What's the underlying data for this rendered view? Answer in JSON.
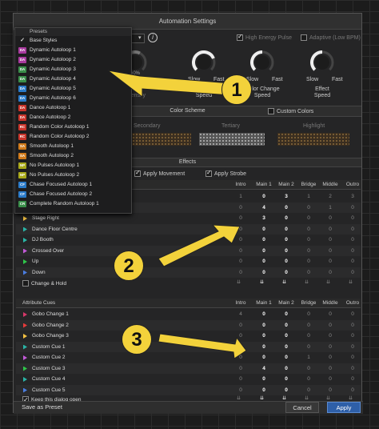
{
  "title": "Automation Settings",
  "top": {
    "high_energy": "High Energy Pulse",
    "adaptive": "Adaptive (Low BPM)",
    "info_icon": "info-icon"
  },
  "knobs": [
    {
      "pct": "60%",
      "label": "Bridge\nIntensity",
      "level": 0.6
    },
    {
      "left": "Slow",
      "right": "Fast",
      "label": "Movement\nSpeed",
      "level": 0.75
    },
    {
      "left": "Slow",
      "right": "Fast",
      "label": "Color Change\nSpeed",
      "level": 0.5
    },
    {
      "left": "Slow",
      "right": "Fast",
      "label": "Effect\nSpeed",
      "level": 0.5
    }
  ],
  "color_scheme": {
    "title": "Color Scheme",
    "custom": "Custom Colors",
    "secondary": "Secondary",
    "tertiary": "Tertiary",
    "highlight": "Highlight"
  },
  "effects": {
    "title": "Effects",
    "apply_movement": "Apply Movement",
    "apply_strobe": "Apply Strobe"
  },
  "columns": [
    "Intro",
    "Main 1",
    "Main 2",
    "Bridge",
    "Middle",
    "Outro"
  ],
  "move_rows": [
    {
      "name": "",
      "values": [
        "1",
        "0",
        "3",
        "1",
        "2",
        "3"
      ],
      "color": ""
    },
    {
      "name": "",
      "values": [
        "0",
        "4",
        "0",
        "0",
        "1",
        "0"
      ],
      "color": ""
    },
    {
      "name": "Stage Right",
      "values": [
        "0",
        "3",
        "0",
        "0",
        "0",
        "0"
      ],
      "color": "#f5c242"
    },
    {
      "name": "Dance Floor Centre",
      "values": [
        "0",
        "0",
        "0",
        "0",
        "0",
        "0"
      ],
      "color": "#2ab4a6"
    },
    {
      "name": "DJ Booth",
      "values": [
        "0",
        "0",
        "0",
        "0",
        "0",
        "0"
      ],
      "color": "#2ab4a6"
    },
    {
      "name": "Crossed Over",
      "values": [
        "0",
        "0",
        "0",
        "0",
        "0",
        "0"
      ],
      "color": "#c25ad8"
    },
    {
      "name": "Up",
      "values": [
        "0",
        "0",
        "0",
        "0",
        "0",
        "0"
      ],
      "color": "#2fc64a"
    },
    {
      "name": "Down",
      "values": [
        "0",
        "0",
        "0",
        "0",
        "0",
        "0"
      ],
      "color": "#4a7de0"
    }
  ],
  "change_hold": "Change & Hold",
  "attr_header": "Attribute Cues",
  "attr_rows": [
    {
      "name": "Gobo Change 1",
      "values": [
        "4",
        "0",
        "0",
        "0",
        "0",
        "0"
      ],
      "color": "#d8386a"
    },
    {
      "name": "Gobo Change 2",
      "values": [
        "0",
        "0",
        "0",
        "0",
        "0",
        "0"
      ],
      "color": "#e53b3b"
    },
    {
      "name": "Gobo Change 3",
      "values": [
        "0",
        "0",
        "0",
        "0",
        "0",
        "0"
      ],
      "color": "#f5c242"
    },
    {
      "name": "Custom Cue 1",
      "values": [
        "0",
        "0",
        "0",
        "0",
        "0",
        "0"
      ],
      "color": "#2ab4a6"
    },
    {
      "name": "Custom Cue 2",
      "values": [
        "0",
        "0",
        "0",
        "1",
        "0",
        "0"
      ],
      "color": "#c25ad8"
    },
    {
      "name": "Custom Cue 3",
      "values": [
        "0",
        "4",
        "0",
        "0",
        "0",
        "0"
      ],
      "color": "#2fc64a"
    },
    {
      "name": "Custom Cue 4",
      "values": [
        "0",
        "0",
        "0",
        "0",
        "0",
        "0"
      ],
      "color": "#2ab4a6"
    },
    {
      "name": "Custom Cue 5",
      "values": [
        "0",
        "0",
        "0",
        "0",
        "0",
        "0"
      ],
      "color": "#4a7de0"
    }
  ],
  "keep_open": "Keep this dialog open",
  "footer": {
    "save": "Save as Preset",
    "cancel": "Cancel",
    "apply": "Apply"
  },
  "menu": {
    "title": "Presets",
    "items": [
      {
        "badge": "✓",
        "label": "Base Styles",
        "color": ""
      },
      {
        "badge": "DA",
        "label": "Dynamic Autoloop 1",
        "color": "#a83a9e"
      },
      {
        "badge": "DA",
        "label": "Dynamic Autoloop 2",
        "color": "#a83a9e"
      },
      {
        "badge": "DA",
        "label": "Dynamic Autoloop 3",
        "color": "#3a8e4a"
      },
      {
        "badge": "DA",
        "label": "Dynamic Autoloop 4",
        "color": "#3a8e4a"
      },
      {
        "badge": "DA",
        "label": "Dynamic Autoloop 5",
        "color": "#2a7ac8"
      },
      {
        "badge": "DA",
        "label": "Dynamic Autoloop 6",
        "color": "#2a7ac8"
      },
      {
        "badge": "DA",
        "label": "Dance Autoloop 1",
        "color": "#c8342a"
      },
      {
        "badge": "DA",
        "label": "Dance Autoloop 2",
        "color": "#c8342a"
      },
      {
        "badge": "RC",
        "label": "Random Color Autoloop 1",
        "color": "#c8342a"
      },
      {
        "badge": "RC",
        "label": "Random Color Autoloop 2",
        "color": "#c8342a"
      },
      {
        "badge": "SA",
        "label": "Smooth Autoloop 1",
        "color": "#d07a1a"
      },
      {
        "badge": "SA",
        "label": "Smooth Autoloop 2",
        "color": "#d07a1a"
      },
      {
        "badge": "NP",
        "label": "No Pulses Autoloop 1",
        "color": "#a8a81a"
      },
      {
        "badge": "NP",
        "label": "No Pulses Autoloop 2",
        "color": "#a8a81a"
      },
      {
        "badge": "CF",
        "label": "Chase Focused Autoloop 1",
        "color": "#2a7ac8"
      },
      {
        "badge": "CF",
        "label": "Chase Focused Autoloop 2",
        "color": "#2a7ac8"
      },
      {
        "badge": "CR",
        "label": "Complete Random Autoloop 1",
        "color": "#3a8e4a"
      }
    ]
  },
  "callouts": [
    "1",
    "2",
    "3"
  ]
}
